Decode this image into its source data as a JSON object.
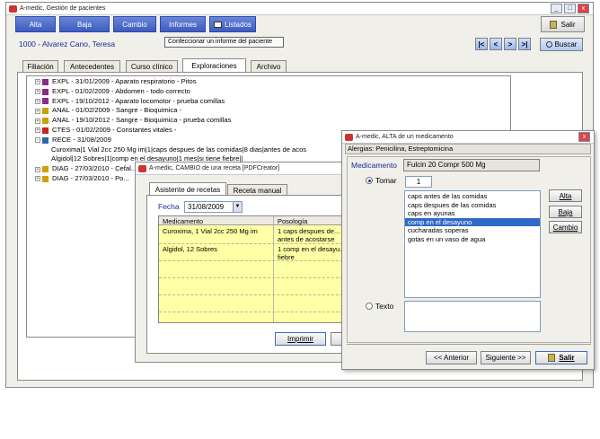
{
  "main": {
    "title": "A-medic, Gestión de pacientes",
    "nav": [
      "Alta",
      "Baja",
      "Cambio",
      "Informes",
      "Listados"
    ],
    "salir": "Salir",
    "patient": "1000 - Alvarez Cano, Teresa",
    "tooltip": "Confeccionar un informe del paciente",
    "buscar": "Buscar",
    "tabs": [
      "Filiación",
      "Antecedentes",
      "Curso clínico",
      "Exploraciones",
      "Archivo"
    ],
    "tree": [
      {
        "t": "EXPL - 31/01/2009 - Aparato respiratorio - Pitos",
        "c": "#8a2a8a"
      },
      {
        "t": "EXPL - 01/02/2009 - Abdomen - todo correcto",
        "c": "#8a2a8a"
      },
      {
        "t": "EXPL - 19/10/2012 - Aparato locomotor - prueba comillas",
        "c": "#8a2a8a"
      },
      {
        "t": "ANAL - 01/02/2009 - Sangre - Bioquimica -",
        "c": "#c8a000"
      },
      {
        "t": "ANAL - 19/10/2012 - Sangre - Bioquimica - prueba comillas",
        "c": "#c8a000"
      },
      {
        "t": "CTES - 01/02/2009 - Constantes vitales -",
        "c": "#cc2222"
      },
      {
        "t": "RECE - 31/08/2009",
        "c": "#3366aa"
      },
      {
        "t": "Curoxima|1 Vial 2cc 250 Mg im|1|caps despues de las comidas|8 dias|antes de acos",
        "c": ""
      },
      {
        "t": "Algidol|12 Sobres|1|comp en el desayuno|1 mes|si tiene fiebre||",
        "c": ""
      },
      {
        "t": "DIAG - 27/03/2010 - Cefal...",
        "c": "#d4a000"
      },
      {
        "t": "DIAG - 27/03/2010 - Po...",
        "c": "#d4a000"
      }
    ]
  },
  "receta": {
    "title": "A-medic, CAMBIO de una receta  [PDFCreator]",
    "tabs": [
      "Asistente de recetas",
      "Receta manual"
    ],
    "fecha_label": "Fecha",
    "fecha": "31/08/2009",
    "cols": [
      "Medicamento",
      "Posología"
    ],
    "rows": [
      [
        "Curoxima, 1 Vial 2cc 250 Mg im",
        "1 caps despues de... antes de acostarse"
      ],
      [
        "Algidol, 12 Sobres",
        "1 comp en el desayu... fiebre"
      ]
    ],
    "imprimir": "Imprimir"
  },
  "alta": {
    "title": "A-medic, ALTA de un medicamento",
    "alergias": "Alergias: Penicilina, Estreptomicina",
    "med_label": "Medicamento",
    "med_value": "Fulcin 20 Compr 500 Mg",
    "tomar_label": "Tomar",
    "tomar_qty": "1",
    "options": [
      "caps antes de las comidas",
      "caps despues de las comidas",
      "caps en ayunas",
      "comp en el desayuno",
      "cucharadas soperas",
      "gotas en un vaso de agua"
    ],
    "selected_index": 3,
    "btns": [
      "Alta",
      "Baja",
      "Cambio"
    ],
    "texto_label": "Texto",
    "anterior": "<< Anterior",
    "siguiente": "Siguiente >>",
    "salir": "Salir"
  }
}
